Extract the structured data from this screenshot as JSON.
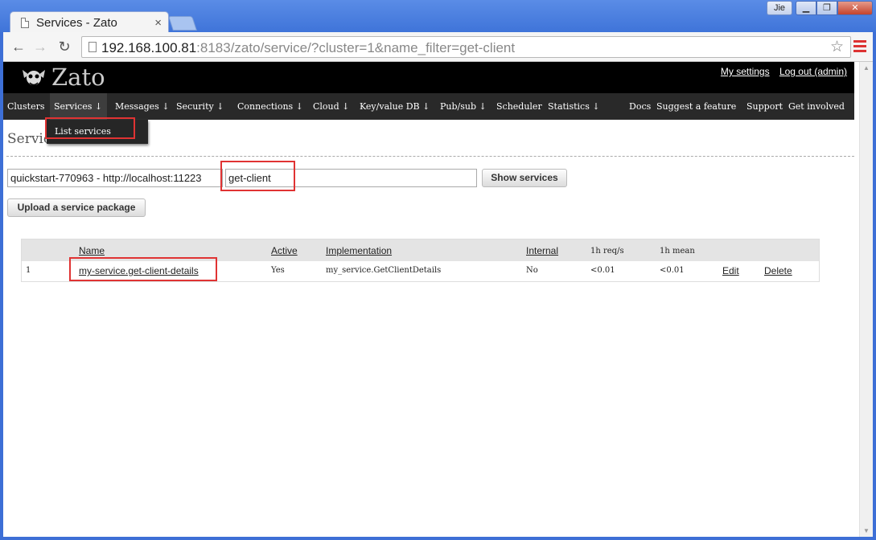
{
  "browser": {
    "tab_title": "Services - Zato",
    "tab_close": "×",
    "user_name": "Jie",
    "win_min": "▁",
    "win_max": "❐",
    "win_close": "✕",
    "back_glyph": "←",
    "forward_glyph": "→",
    "reload_glyph": "↻",
    "star_glyph": "☆",
    "url_host": "192.168.100.81",
    "url_rest": ":8183/zato/service/?cluster=1&name_filter=get-client"
  },
  "header": {
    "logo_text": "Zato",
    "my_settings": "My settings",
    "logout": "Log out (admin)"
  },
  "nav": {
    "clusters": "Clusters",
    "services": "Services ↓",
    "messages": "Messages ↓",
    "security": "Security ↓",
    "connections": "Connections ↓",
    "cloud": "Cloud ↓",
    "kv_db": "Key/value DB ↓",
    "pubsub": "Pub/sub ↓",
    "scheduler": "Scheduler",
    "statistics": "Statistics ↓",
    "docs": "Docs",
    "suggest": "Suggest a feature",
    "support": "Support",
    "get_involved": "Get involved"
  },
  "dropdown": {
    "list_services": "List services"
  },
  "page": {
    "title": "Services"
  },
  "filter": {
    "cluster_value": "quickstart-770963 - http://localhost:11223",
    "name_filter_value": "get-client",
    "show_button": "Show services",
    "upload_button": "Upload a service package"
  },
  "table": {
    "headers": {
      "name": "Name",
      "active": "Active",
      "implementation": "Implementation",
      "internal": "Internal",
      "req_s": "1h req/s",
      "mean": "1h mean"
    },
    "rows": [
      {
        "index": "1",
        "name": "my-service.get-client-details",
        "active": "Yes",
        "implementation": "my_service.GetClientDetails",
        "internal": "No",
        "req_s": "<0.01",
        "mean": "<0.01",
        "edit": "Edit",
        "delete": "Delete"
      }
    ]
  },
  "colors": {
    "highlight_box": "#e03333",
    "header_bg": "#000000",
    "nav_bg": "#292929"
  }
}
